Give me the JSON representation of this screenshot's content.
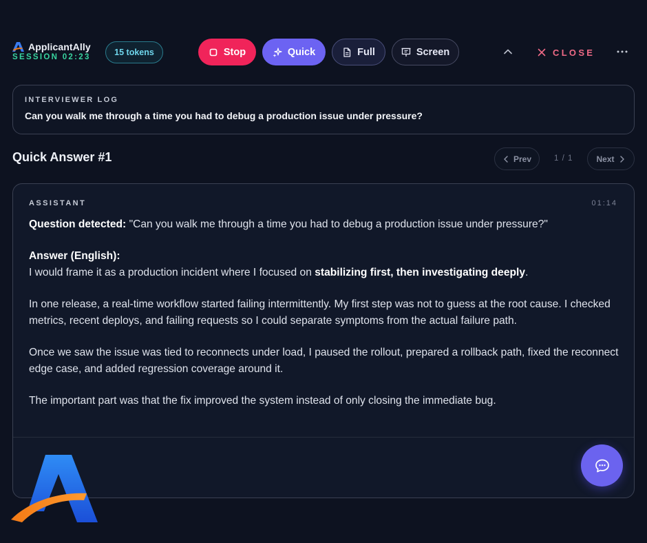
{
  "header": {
    "app_name": "ApplicantAlly",
    "session": "SESSION 02:23",
    "tokens": "15 tokens",
    "buttons": {
      "stop": "Stop",
      "quick": "Quick",
      "full": "Full",
      "screen": "Screen",
      "close": "CLOSE"
    }
  },
  "interviewer_log": {
    "label": "INTERVIEWER LOG",
    "text": "Can you walk me through a time you had to debug a production issue under pressure?"
  },
  "quick_answer": {
    "title": "Quick Answer #1",
    "prev": "Prev",
    "next": "Next",
    "page": "1 / 1"
  },
  "assistant": {
    "label": "ASSISTANT",
    "time": "01:14",
    "question_label": "Question detected:",
    "question_text": " \"Can you walk me through a time you had to debug a production issue under pressure?\"",
    "answer_label": "Answer (English):",
    "answer_intro": "I would frame it as a production incident where I focused on ",
    "answer_intro_bold": "stabilizing first, then investigating deeply",
    "answer_intro_end": ".",
    "paragraph_2": "In one release, a real-time workflow started failing intermittently. My first step was not to guess at the root cause. I checked metrics, recent deploys, and failing requests so I could separate symptoms from the actual failure path.",
    "paragraph_3": "Once we saw the issue was tied to reconnects under load, I paused the rollout, prepared a rollback path, fixed the reconnect edge case, and added regression coverage around it.",
    "paragraph_4": "The important part was that the fix improved the system instead of only closing the immediate bug."
  },
  "icons": {
    "brand": "applicantally-logo-icon",
    "stop": "stop-square-icon",
    "quick": "sparkles-icon",
    "full": "document-icon",
    "screen": "presentation-screen-icon",
    "collapse": "chevron-up-icon",
    "close": "close-icon",
    "menu": "more-dots-icon",
    "prev": "chevron-left-icon",
    "next": "chevron-right-icon",
    "chat": "chat-bubble-icon"
  },
  "colors": {
    "background": "#0d1220",
    "stop": "#f0245a",
    "quick": "#6c63f2",
    "session": "#38d39f",
    "close": "#ef6a86",
    "tokens": "#6fd6ec"
  }
}
